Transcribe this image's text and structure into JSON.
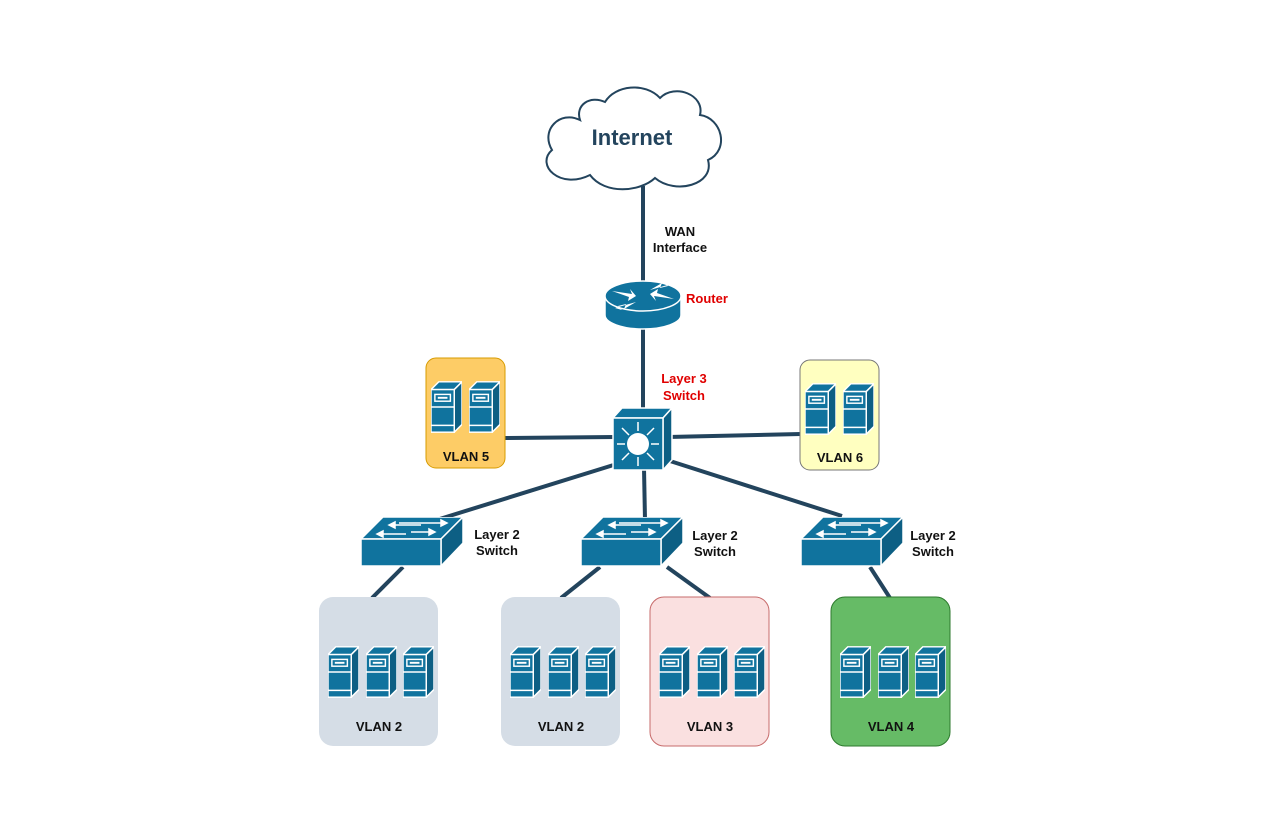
{
  "colors": {
    "device": "#10739e",
    "link": "#23445d",
    "cloud_text": "#23445d",
    "red_label": "#e00000",
    "vlan2_fill": "#d5dde6",
    "vlan3_fill": "#fae0e0",
    "vlan4_fill": "#66bb66",
    "vlan5_fill": "#fdcc66",
    "vlan6_fill": "#ffffc0"
  },
  "internet": {
    "label": "Internet",
    "icon": "cloud-icon"
  },
  "wan": {
    "line1": "WAN",
    "line2": "Interface"
  },
  "router": {
    "label": "Router",
    "icon": "router-icon"
  },
  "l3switch": {
    "line1": "Layer 3",
    "line2": "Switch",
    "icon": "layer3-switch-icon"
  },
  "l2switches": [
    {
      "line1": "Layer 2",
      "line2": "Switch"
    },
    {
      "line1": "Layer 2",
      "line2": "Switch"
    },
    {
      "line1": "Layer 2",
      "line2": "Switch"
    }
  ],
  "vlans": {
    "vlan5": "VLAN 5",
    "vlan6": "VLAN 6",
    "vlan2a": "VLAN 2",
    "vlan2b": "VLAN 2",
    "vlan3": "VLAN 3",
    "vlan4": "VLAN 4"
  }
}
